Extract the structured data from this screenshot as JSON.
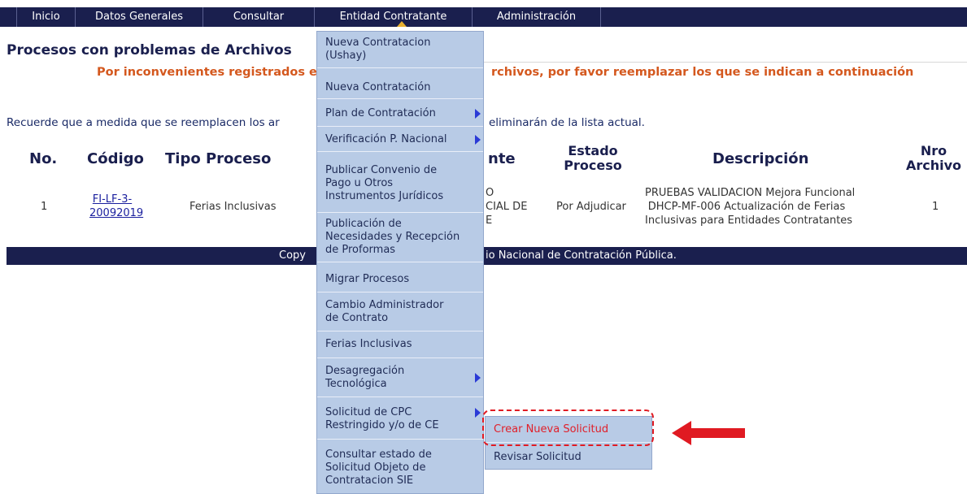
{
  "nav": {
    "items": [
      "Inicio",
      "Datos Generales",
      "Consultar",
      "Entidad Contratante",
      "Administración"
    ]
  },
  "page": {
    "title": "Procesos con problemas de Archivos",
    "warning_left": "Por inconvenientes registrados en",
    "warning_right": "rchivos, por favor reemplazar los que se indican a continuación",
    "reminder_left": "Recuerde que a medida que se reemplacen los ar",
    "reminder_right": "eliminarán de la lista actual."
  },
  "table": {
    "headers": {
      "no": "No.",
      "codigo": "Código",
      "tipo": "Tipo Proceso",
      "entidad": "nte",
      "estado_1": "Estado",
      "estado_2": "Proceso",
      "descripcion": "Descripción",
      "nro_1": "Nro",
      "nro_2": "Archivo"
    },
    "row": {
      "no": "1",
      "codigo_1": "FI-LF-3-",
      "codigo_2": "20092019",
      "tipo": "Ferias Inclusivas",
      "entidad_1": "O",
      "entidad_2": "CIAL DE",
      "entidad_3": "E",
      "estado": "Por Adjudicar",
      "desc_1": "PRUEBAS VALIDACION Mejora Funcional",
      "desc_2": "DHCP-MF-006 Actualización de Ferias",
      "desc_3": "Inclusivas para Entidades Contratantes",
      "nro": "1"
    }
  },
  "footer": {
    "left": "Copy",
    "right": "io Nacional de Contratación Pública."
  },
  "menu": {
    "items": [
      {
        "l1": "Nueva Contratacion",
        "l2": "(Ushay)"
      },
      {
        "l1": "Nueva Contratación"
      },
      {
        "l1": "Plan de Contratación"
      },
      {
        "l1": "Verificación P. Nacional"
      },
      {
        "l1": "Publicar Convenio de",
        "l2": "Pago u Otros",
        "l3": "Instrumentos Jurídicos"
      },
      {
        "l1": "Publicación de",
        "l2": "Necesidades y Recepción",
        "l3": "de Proformas"
      },
      {
        "l1": "Migrar Procesos"
      },
      {
        "l1": "Cambio Administrador",
        "l2": "de Contrato"
      },
      {
        "l1": "Ferias Inclusivas"
      },
      {
        "l1": "Desagregación",
        "l2": "Tecnológica"
      },
      {
        "l1": "Solicitud de CPC",
        "l2": "Restringido y/o de CE"
      },
      {
        "l1": "Consultar estado de",
        "l2": "Solicitud Objeto de",
        "l3": "Contratacion SIE"
      }
    ]
  },
  "submenu": {
    "create": "Crear Nueva Solicitud",
    "review": "Revisar Solicitud"
  },
  "colors": {
    "nav_bg": "#1a1f4e",
    "menu_bg": "#b8cbe6",
    "warning": "#d4581e",
    "highlight_red": "#e01a22"
  }
}
